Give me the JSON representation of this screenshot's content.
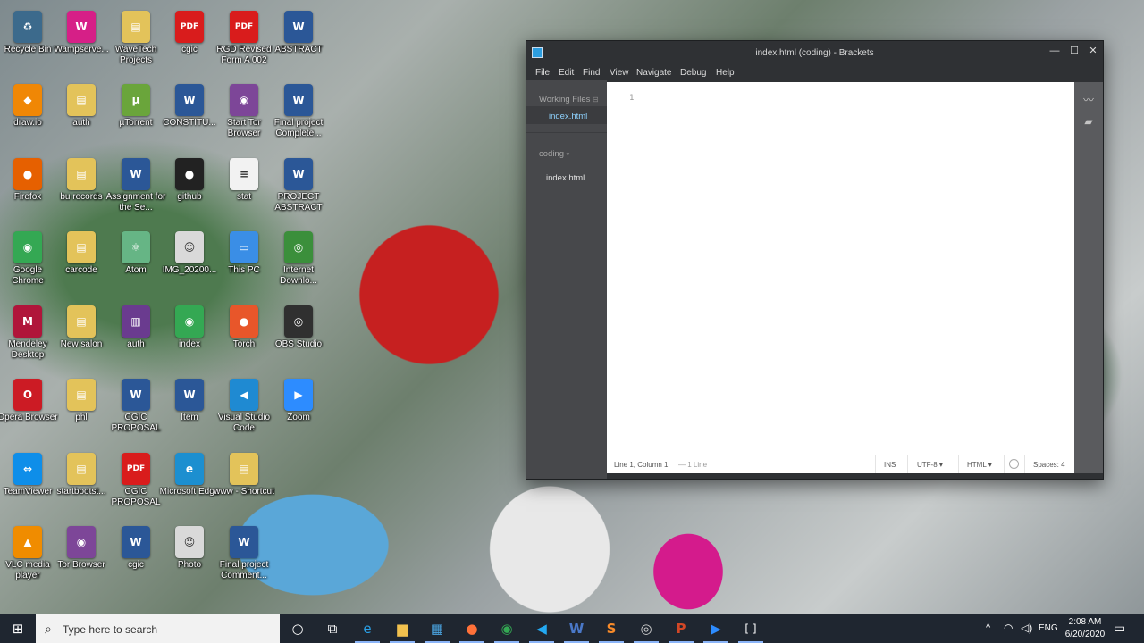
{
  "desktop": {
    "icons": [
      {
        "label": "Recycle Bin",
        "glyph": "♻",
        "color": "#3c6a8c"
      },
      {
        "label": "Wampserve...",
        "glyph": "W",
        "color": "#d61f87"
      },
      {
        "label": "WaveTech Projects",
        "glyph": "▤",
        "color": "#e3c35a"
      },
      {
        "label": "cgic",
        "glyph": "PDF",
        "color": "#d91c1c"
      },
      {
        "label": "RGD Revised Form A 002",
        "glyph": "PDF",
        "color": "#d91c1c"
      },
      {
        "label": "ABSTRACT",
        "glyph": "W",
        "color": "#2b5797"
      },
      {
        "label": "draw.io",
        "glyph": "◆",
        "color": "#f08705"
      },
      {
        "label": "auth",
        "glyph": "▤",
        "color": "#e3c35a"
      },
      {
        "label": "µTorrent",
        "glyph": "µ",
        "color": "#6aa53b"
      },
      {
        "label": "CONSTITU...",
        "glyph": "W",
        "color": "#2b5797"
      },
      {
        "label": "Start Tor Browser",
        "glyph": "◉",
        "color": "#7d4698"
      },
      {
        "label": "Final project Complete...",
        "glyph": "W",
        "color": "#2b5797"
      },
      {
        "label": "Firefox",
        "glyph": "●",
        "color": "#e66000"
      },
      {
        "label": "bu records",
        "glyph": "▤",
        "color": "#e3c35a"
      },
      {
        "label": "Assignment for the Se...",
        "glyph": "W",
        "color": "#2b5797"
      },
      {
        "label": "github",
        "glyph": "●",
        "color": "#222222"
      },
      {
        "label": "stat",
        "glyph": "≡",
        "color": "#f2f2f2"
      },
      {
        "label": "PROJECT ABSTRACT",
        "glyph": "W",
        "color": "#2b5797"
      },
      {
        "label": "Google Chrome",
        "glyph": "◉",
        "color": "#34a853"
      },
      {
        "label": "carcode",
        "glyph": "▤",
        "color": "#e3c35a"
      },
      {
        "label": "Atom",
        "glyph": "⚛",
        "color": "#66b585"
      },
      {
        "label": "IMG_20200...",
        "glyph": "☺",
        "color": "#d9d9d9"
      },
      {
        "label": "This PC",
        "glyph": "▭",
        "color": "#3a8ee6"
      },
      {
        "label": "Internet Downlo...",
        "glyph": "◎",
        "color": "#3b8f3b"
      },
      {
        "label": "Mendeley Desktop",
        "glyph": "M",
        "color": "#b0153a"
      },
      {
        "label": "New salon",
        "glyph": "▤",
        "color": "#e3c35a"
      },
      {
        "label": "auth",
        "glyph": "▥",
        "color": "#6a3b8f"
      },
      {
        "label": "index",
        "glyph": "◉",
        "color": "#34a853"
      },
      {
        "label": "Torch",
        "glyph": "●",
        "color": "#e8562a"
      },
      {
        "label": "OBS Studio",
        "glyph": "◎",
        "color": "#303030"
      },
      {
        "label": "Opera Browser",
        "glyph": "O",
        "color": "#cc1b24"
      },
      {
        "label": "phl",
        "glyph": "▤",
        "color": "#e3c35a"
      },
      {
        "label": "CGIC PROPOSAL",
        "glyph": "W",
        "color": "#2b5797"
      },
      {
        "label": "Item",
        "glyph": "W",
        "color": "#2b5797"
      },
      {
        "label": "Visual Studio Code",
        "glyph": "◀",
        "color": "#1f8ad2"
      },
      {
        "label": "Zoom",
        "glyph": "▶",
        "color": "#2d8cff"
      },
      {
        "label": "TeamViewer",
        "glyph": "⇔",
        "color": "#0e8ee9"
      },
      {
        "label": "startbootst...",
        "glyph": "▤",
        "color": "#e3c35a"
      },
      {
        "label": "CGIC PROPOSAL",
        "glyph": "PDF",
        "color": "#d91c1c"
      },
      {
        "label": "Microsoft Edge",
        "glyph": "e",
        "color": "#1c8fd0"
      },
      {
        "label": "www - Shortcut",
        "glyph": "▤",
        "color": "#e3c35a"
      },
      {
        "label": "",
        "glyph": "",
        "color": "transparent"
      },
      {
        "label": "VLC media player",
        "glyph": "▲",
        "color": "#f08c00"
      },
      {
        "label": "Tor Browser",
        "glyph": "◉",
        "color": "#7d4698"
      },
      {
        "label": "cgic",
        "glyph": "W",
        "color": "#2b5797"
      },
      {
        "label": "Photo",
        "glyph": "☺",
        "color": "#d9d9d9"
      },
      {
        "label": "Final project Comment...",
        "glyph": "W",
        "color": "#2b5797"
      },
      {
        "label": "",
        "glyph": "",
        "color": "transparent"
      }
    ]
  },
  "window": {
    "title": "index.html (coding) - Brackets",
    "controls": {
      "minimize": "—",
      "maximize": "☐",
      "close": "✕"
    },
    "menu": [
      "File",
      "Edit",
      "Find",
      "View",
      "Navigate",
      "Debug",
      "Help"
    ],
    "sidebar": {
      "working_files_label": "Working Files",
      "working_files": [
        "index.html"
      ],
      "project_label": "coding",
      "project_files": [
        "index.html"
      ]
    },
    "editor": {
      "line_numbers": [
        "1"
      ]
    },
    "statusbar": {
      "cursor": "Line 1, Column 1",
      "lines": "— 1 Line",
      "mode": "INS",
      "encoding": "UTF-8",
      "language": "HTML",
      "spaces": "Spaces: 4"
    }
  },
  "taskbar": {
    "search_placeholder": "Type here to search",
    "apps": [
      {
        "name": "cortana-icon",
        "glyph": "○",
        "color": "#ffffff"
      },
      {
        "name": "task-view-icon",
        "glyph": "⧉",
        "color": "#ffffff"
      },
      {
        "name": "edge-icon",
        "glyph": "e",
        "color": "#2aa0e6"
      },
      {
        "name": "file-explorer-icon",
        "glyph": "▆",
        "color": "#f2c14e"
      },
      {
        "name": "store-icon",
        "glyph": "▦",
        "color": "#4aa3df"
      },
      {
        "name": "firefox-icon",
        "glyph": "●",
        "color": "#ff7139"
      },
      {
        "name": "chrome-icon",
        "glyph": "◉",
        "color": "#34a853"
      },
      {
        "name": "vscode-icon",
        "glyph": "◀",
        "color": "#23a9f2"
      },
      {
        "name": "word-icon",
        "glyph": "W",
        "color": "#4a78c8"
      },
      {
        "name": "sublime-icon",
        "glyph": "S",
        "color": "#f98b29"
      },
      {
        "name": "obs-icon",
        "glyph": "◎",
        "color": "#d0d0d0"
      },
      {
        "name": "powerpoint-icon",
        "glyph": "P",
        "color": "#d24726"
      },
      {
        "name": "zoom-icon",
        "glyph": "▶",
        "color": "#2d8cff"
      },
      {
        "name": "brackets-icon",
        "glyph": "[ ]",
        "color": "#ffffff"
      }
    ],
    "tray": {
      "chevron": "^",
      "language": "ENG",
      "time": "2:08 AM",
      "date": "6/20/2020"
    }
  }
}
